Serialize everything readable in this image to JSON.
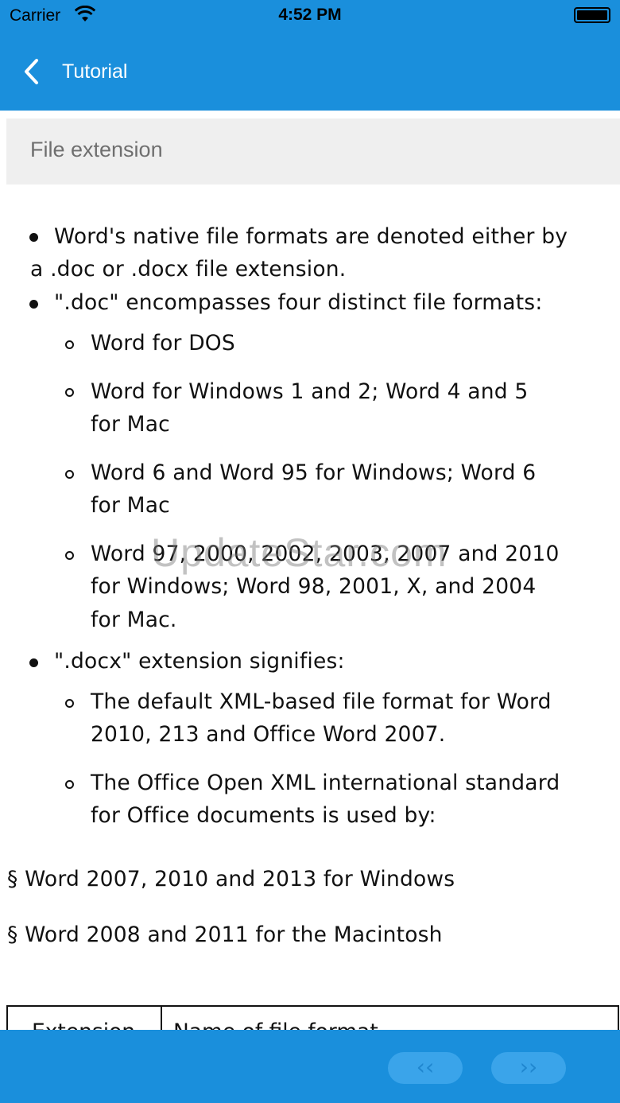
{
  "status_bar": {
    "carrier": "Carrier",
    "time": "4:52 PM",
    "wifi_icon": "wifi-icon",
    "battery_icon": "battery-icon"
  },
  "nav": {
    "back_icon": "chevron-left-icon",
    "back_label": "Tutorial"
  },
  "section": {
    "title": "File extension"
  },
  "content": {
    "b1_l1": "Word's native file formats are denoted either by",
    "b1_l2": "a .doc or .docx file extension.",
    "b2": "\".doc\" encompasses four distinct file formats:",
    "s1": "Word for DOS",
    "s2_l1": "Word for Windows 1 and 2; Word 4 and 5",
    "s2_l2": "for Mac",
    "s3_l1": "Word 6 and Word 95 for Windows; Word 6",
    "s3_l2": "for Mac",
    "s4_l1": "Word 97, 2000, 2002, 2003, 2007 and 2010",
    "s4_l2": "for Windows; Word 98, 2001, X, and 2004",
    "s4_l3": "for Mac.",
    "b3": "\".docx\" extension signifies:",
    "s5_l1": "The default XML-based file format for Word",
    "s5_l2": "2010, 213 and Office Word 2007.",
    "s6_l1": "The Office Open XML international standard",
    "s6_l2": "for Office documents is used by:",
    "p1": "§ Word 2007, 2010 and 2013 for Windows",
    "p2": "§ Word 2008 and 2011 for the Macintosh"
  },
  "table": {
    "headers": [
      "Extension",
      "Name of file format"
    ]
  },
  "watermark": "UpdateStar.com",
  "pager": {
    "prev_label": "‹‹",
    "next_label": "››"
  },
  "colors": {
    "accent": "#1a8fdc",
    "header_bg": "#efefef",
    "button_bg": "#3aa4ea"
  }
}
